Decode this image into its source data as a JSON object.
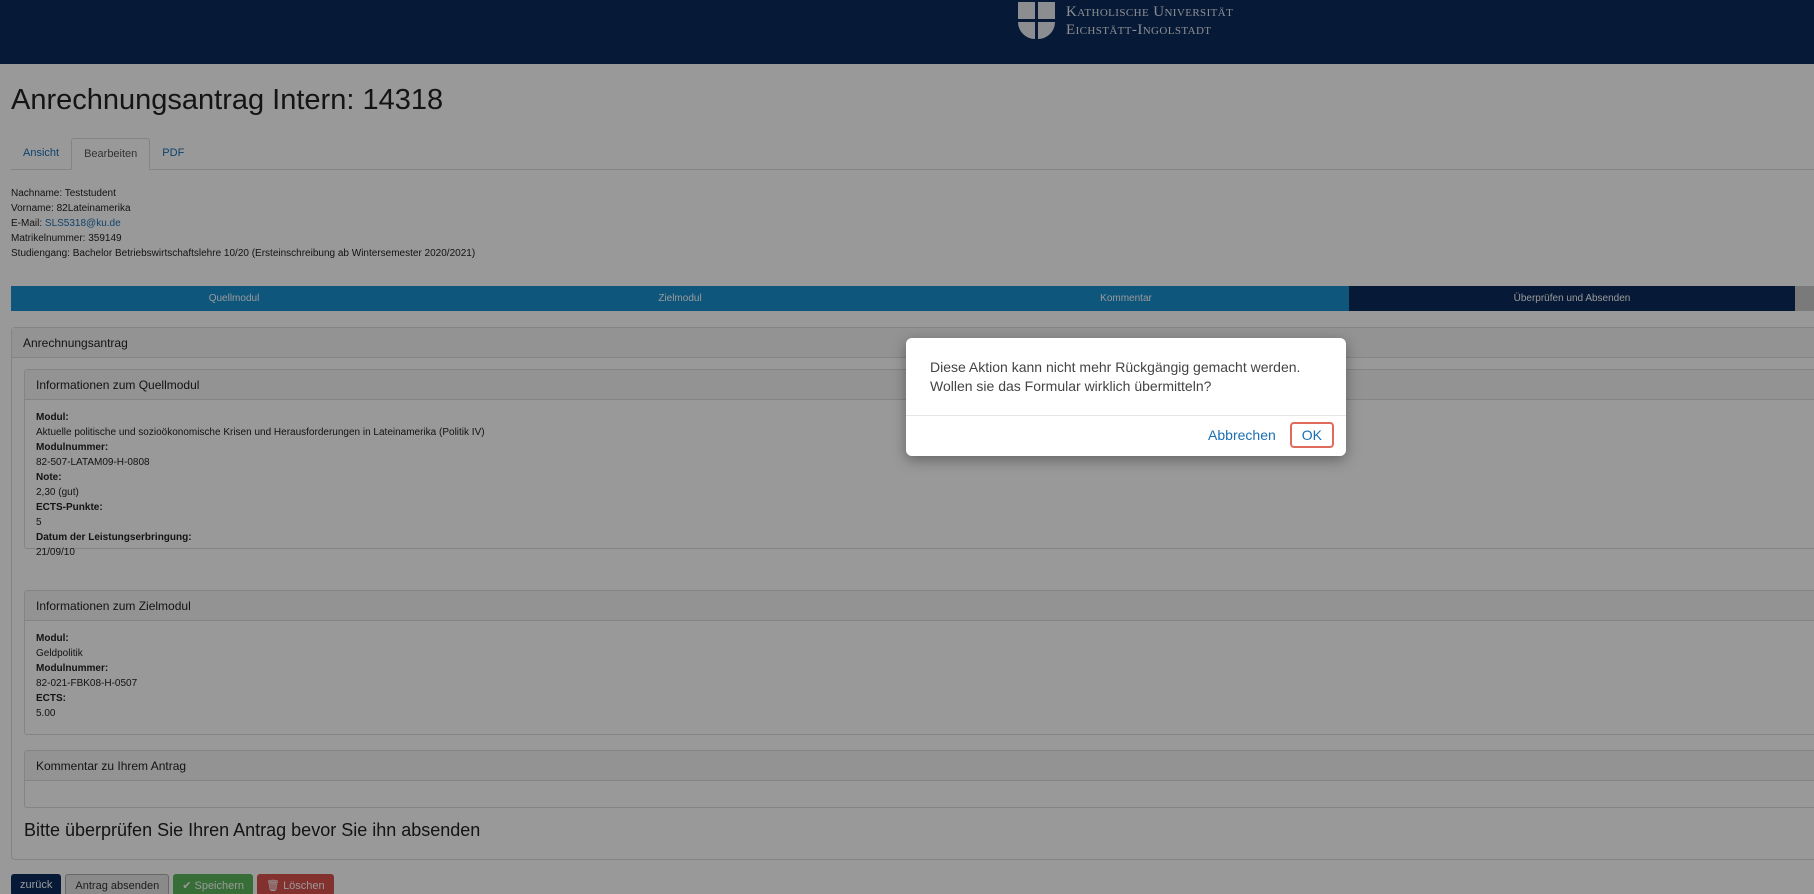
{
  "header": {
    "logo_line1": "Katholische Universität",
    "logo_line2": "Eichstätt-Ingolstadt"
  },
  "page": {
    "title": "Anrechnungsantrag Intern: 14318"
  },
  "tabs": [
    {
      "label": "Ansicht"
    },
    {
      "label": "Bearbeiten"
    },
    {
      "label": "PDF"
    }
  ],
  "student": {
    "lastname_label": "Nachname:",
    "lastname": "Teststudent",
    "firstname_label": "Vorname:",
    "firstname": "82Lateinamerika",
    "email_label": "E-Mail:",
    "email": "SLS5318@ku.de",
    "matrikel_label": "Matrikelnummer:",
    "matrikel": "359149",
    "program_label": "Studiengang:",
    "program": "Bachelor Betriebswirtschaftslehre 10/20 (Ersteinschreibung ab Wintersemester 2020/2021)"
  },
  "steps": [
    {
      "label": "Quellmodul"
    },
    {
      "label": "Zielmodul"
    },
    {
      "label": "Kommentar"
    },
    {
      "label": "Überprüfen und Absenden"
    }
  ],
  "panel": {
    "heading": "Anrechnungsantrag",
    "source": {
      "heading": "Informationen zum Quellmodul",
      "modul_label": "Modul:",
      "modul": "Aktuelle politische und sozioökonomische Krisen und Herausforderungen in Lateinamerika (Politik IV)",
      "nummer_label": "Modulnummer:",
      "nummer": "82-507-LATAM09-H-0808",
      "note_label": "Note:",
      "note": "2,30 (gut)",
      "ects_label": "ECTS-Punkte:",
      "ects": "5",
      "datum_label": "Datum der Leistungserbringung:",
      "datum": "21/09/10"
    },
    "target": {
      "heading": "Informationen zum Zielmodul",
      "modul_label": "Modul:",
      "modul": "Geldpolitik",
      "nummer_label": "Modulnummer:",
      "nummer": "82-021-FBK08-H-0507",
      "ects_label": "ECTS:",
      "ects": "5.00"
    },
    "comment": {
      "heading": "Kommentar zu Ihrem Antrag"
    },
    "review_text": "Bitte überprüfen Sie Ihren Antrag bevor Sie ihn absenden"
  },
  "buttons": {
    "back": "zurück",
    "submit": "Antrag absenden",
    "save": "Speichern",
    "delete": "Löschen"
  },
  "dialog": {
    "message_line1": "Diese Aktion kann nicht mehr Rückgängig gemacht werden.",
    "message_line2": "Wollen sie das Formular wirklich übermitteln?",
    "cancel": "Abbrechen",
    "ok": "OK"
  },
  "colors": {
    "header": "#0a2a5c",
    "step_active": "#1a8fd1",
    "step_current": "#0a2a5c",
    "ok_outline": "#e06b5c"
  }
}
